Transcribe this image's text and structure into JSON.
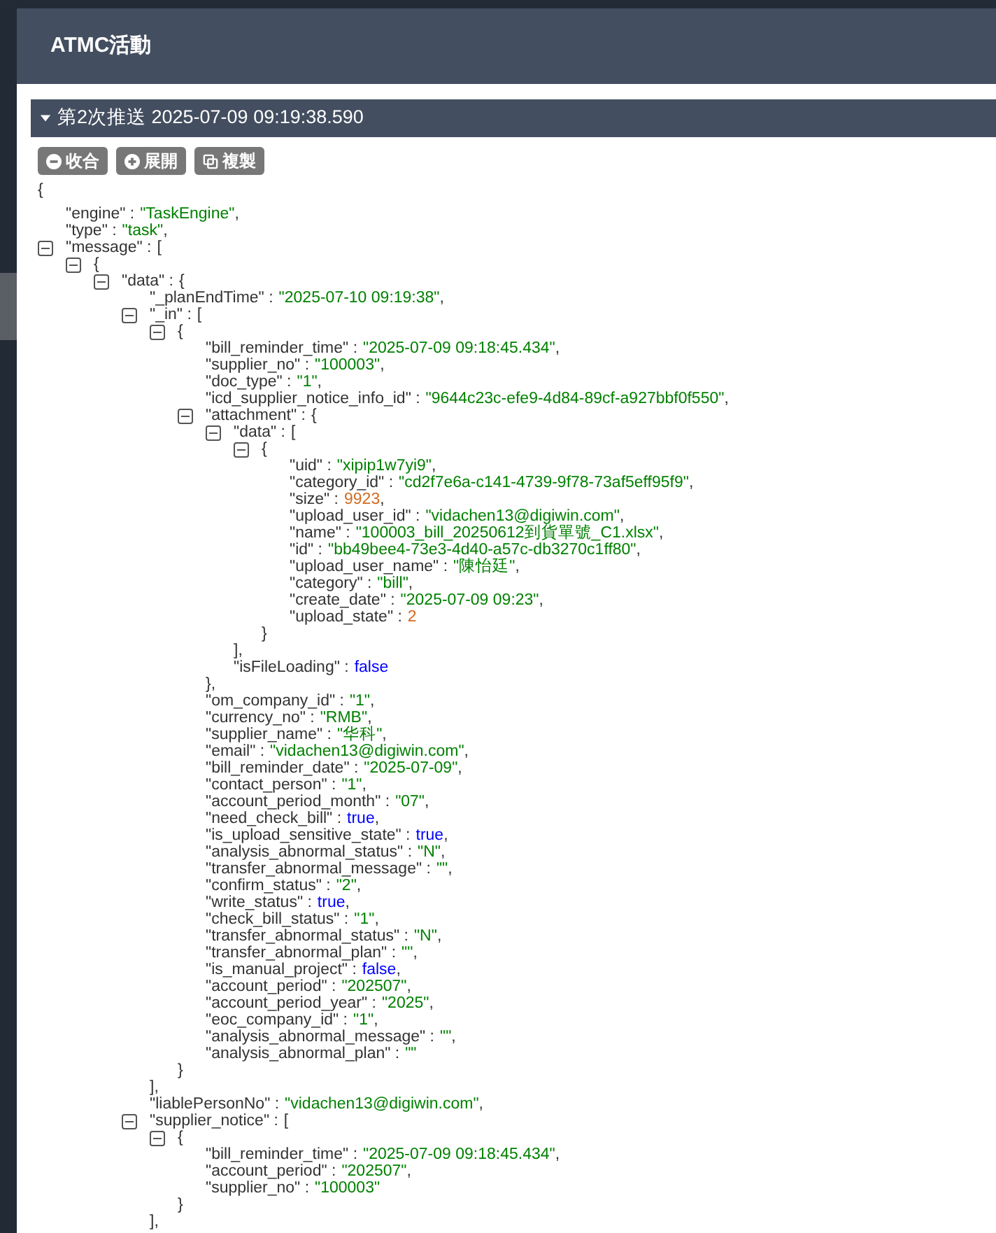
{
  "window": {
    "title": "ATMC活動"
  },
  "section": {
    "title": "第2次推送 2025-07-09 09:19:38.590",
    "expanded": true
  },
  "buttons": [
    {
      "label": "收合",
      "kind": "collapse"
    },
    {
      "label": "展開",
      "kind": "expand"
    },
    {
      "label": "複製",
      "kind": "copy"
    }
  ],
  "tree": {
    "kind": "root",
    "open": "{",
    "children": [
      {
        "kind": "value",
        "key": "\"engine\" :",
        "value": "\"TaskEngine\"",
        "color": "#008000",
        "tail": ","
      },
      {
        "kind": "value",
        "key": "\"type\" :",
        "value": "\"task\"",
        "color": "#008000",
        "tail": ","
      },
      {
        "kind": "container",
        "key": "\"message\" :",
        "open": "[",
        "expanded": true,
        "children": [
          {
            "kind": "container",
            "open": "{",
            "expanded": true,
            "children": [
              {
                "kind": "container",
                "key": "\"data\" :",
                "open": "{",
                "expanded": true,
                "children": [
                  {
                    "kind": "value",
                    "key": "\"_planEndTime\" :",
                    "value": "\"2025-07-10 09:19:38\"",
                    "color": "#008000",
                    "tail": ","
                  },
                  {
                    "kind": "container",
                    "key": "\"_in\" :",
                    "open": "[",
                    "expanded": true,
                    "children": [
                      {
                        "kind": "container",
                        "open": "{",
                        "expanded": true,
                        "children": [
                          {
                            "kind": "value",
                            "key": "\"bill_reminder_time\" :",
                            "value": "\"2025-07-09 09:18:45.434\"",
                            "color": "#008000",
                            "tail": ","
                          },
                          {
                            "kind": "value",
                            "key": "\"supplier_no\" :",
                            "value": "\"100003\"",
                            "color": "#008000",
                            "tail": ","
                          },
                          {
                            "kind": "value",
                            "key": "\"doc_type\" :",
                            "value": "\"1\"",
                            "color": "#008000",
                            "tail": ","
                          },
                          {
                            "kind": "value",
                            "key": "\"icd_supplier_notice_info_id\" :",
                            "value": "\"9644c23c-efe9-4d84-89cf-a927bbf0f550\"",
                            "color": "#008000",
                            "tail": ","
                          },
                          {
                            "kind": "container",
                            "key": "\"attachment\" :",
                            "open": "{",
                            "expanded": true,
                            "children": [
                              {
                                "kind": "container",
                                "key": "\"data\" :",
                                "open": "[",
                                "expanded": true,
                                "children": [
                                  {
                                    "kind": "container",
                                    "open": "{",
                                    "expanded": true,
                                    "children": [
                                      {
                                        "kind": "value",
                                        "key": "\"uid\" :",
                                        "value": "\"xipip1w7yi9\"",
                                        "color": "#008000",
                                        "tail": ","
                                      },
                                      {
                                        "kind": "value",
                                        "key": "\"category_id\" :",
                                        "value": "\"cd2f7e6a-c141-4739-9f78-73af5eff95f9\"",
                                        "color": "#008000",
                                        "tail": ","
                                      },
                                      {
                                        "kind": "value",
                                        "key": "\"size\" :",
                                        "value": "9923",
                                        "color": "#d2691e",
                                        "tail": ","
                                      },
                                      {
                                        "kind": "value",
                                        "key": "\"upload_user_id\" :",
                                        "value": "\"vidachen13@digiwin.com\"",
                                        "color": "#008000",
                                        "tail": ","
                                      },
                                      {
                                        "kind": "value",
                                        "key": "\"name\" :",
                                        "value": "\"100003_bill_20250612到貨單號_C1.xlsx\"",
                                        "color": "#008000",
                                        "tail": ","
                                      },
                                      {
                                        "kind": "value",
                                        "key": "\"id\" :",
                                        "value": "\"bb49bee4-73e3-4d40-a57c-db3270c1ff80\"",
                                        "color": "#008000",
                                        "tail": ","
                                      },
                                      {
                                        "kind": "value",
                                        "key": "\"upload_user_name\" :",
                                        "value": "\"陳怡廷\"",
                                        "color": "#008000",
                                        "tail": ","
                                      },
                                      {
                                        "kind": "value",
                                        "key": "\"category\" :",
                                        "value": "\"bill\"",
                                        "color": "#008000",
                                        "tail": ","
                                      },
                                      {
                                        "kind": "value",
                                        "key": "\"create_date\" :",
                                        "value": "\"2025-07-09 09:23\"",
                                        "color": "#008000",
                                        "tail": ","
                                      },
                                      {
                                        "kind": "value",
                                        "key": "\"upload_state\" :",
                                        "value": "2",
                                        "color": "#d2691e"
                                      }
                                    ],
                                    "close": "}"
                                  }
                                ],
                                "close": "],"
                              },
                              {
                                "kind": "value",
                                "key": "\"isFileLoading\" :",
                                "value": "false",
                                "color": "#0000ff"
                              }
                            ],
                            "close": "},"
                          },
                          {
                            "kind": "value",
                            "key": "\"om_company_id\" :",
                            "value": "\"1\"",
                            "color": "#008000",
                            "tail": ","
                          },
                          {
                            "kind": "value",
                            "key": "\"currency_no\" :",
                            "value": "\"RMB\"",
                            "color": "#008000",
                            "tail": ","
                          },
                          {
                            "kind": "value",
                            "key": "\"supplier_name\" :",
                            "value": "\"华科\"",
                            "color": "#008000",
                            "tail": ","
                          },
                          {
                            "kind": "value",
                            "key": "\"email\" :",
                            "value": "\"vidachen13@digiwin.com\"",
                            "color": "#008000",
                            "tail": ","
                          },
                          {
                            "kind": "value",
                            "key": "\"bill_reminder_date\" :",
                            "value": "\"2025-07-09\"",
                            "color": "#008000",
                            "tail": ","
                          },
                          {
                            "kind": "value",
                            "key": "\"contact_person\" :",
                            "value": "\"1\"",
                            "color": "#008000",
                            "tail": ","
                          },
                          {
                            "kind": "value",
                            "key": "\"account_period_month\" :",
                            "value": "\"07\"",
                            "color": "#008000",
                            "tail": ","
                          },
                          {
                            "kind": "value",
                            "key": "\"need_check_bill\" :",
                            "value": "true",
                            "color": "#0000ff",
                            "tail": ","
                          },
                          {
                            "kind": "value",
                            "key": "\"is_upload_sensitive_state\" :",
                            "value": "true",
                            "color": "#0000ff",
                            "tail": ","
                          },
                          {
                            "kind": "value",
                            "key": "\"analysis_abnormal_status\" :",
                            "value": "\"N\"",
                            "color": "#008000",
                            "tail": ","
                          },
                          {
                            "kind": "value",
                            "key": "\"transfer_abnormal_message\" :",
                            "value": "\"\"",
                            "color": "#008000",
                            "tail": ","
                          },
                          {
                            "kind": "value",
                            "key": "\"confirm_status\" :",
                            "value": "\"2\"",
                            "color": "#008000",
                            "tail": ","
                          },
                          {
                            "kind": "value",
                            "key": "\"write_status\" :",
                            "value": "true",
                            "color": "#0000ff",
                            "tail": ","
                          },
                          {
                            "kind": "value",
                            "key": "\"check_bill_status\" :",
                            "value": "\"1\"",
                            "color": "#008000",
                            "tail": ","
                          },
                          {
                            "kind": "value",
                            "key": "\"transfer_abnormal_status\" :",
                            "value": "\"N\"",
                            "color": "#008000",
                            "tail": ","
                          },
                          {
                            "kind": "value",
                            "key": "\"transfer_abnormal_plan\" :",
                            "value": "\"\"",
                            "color": "#008000",
                            "tail": ","
                          },
                          {
                            "kind": "value",
                            "key": "\"is_manual_project\" :",
                            "value": "false",
                            "color": "#0000ff",
                            "tail": ","
                          },
                          {
                            "kind": "value",
                            "key": "\"account_period\" :",
                            "value": "\"202507\"",
                            "color": "#008000",
                            "tail": ","
                          },
                          {
                            "kind": "value",
                            "key": "\"account_period_year\" :",
                            "value": "\"2025\"",
                            "color": "#008000",
                            "tail": ","
                          },
                          {
                            "kind": "value",
                            "key": "\"eoc_company_id\" :",
                            "value": "\"1\"",
                            "color": "#008000",
                            "tail": ","
                          },
                          {
                            "kind": "value",
                            "key": "\"analysis_abnormal_message\" :",
                            "value": "\"\"",
                            "color": "#008000",
                            "tail": ","
                          },
                          {
                            "kind": "value",
                            "key": "\"analysis_abnormal_plan\" :",
                            "value": "\"\"",
                            "color": "#008000"
                          }
                        ],
                        "close": "}"
                      }
                    ],
                    "close": "],"
                  },
                  {
                    "kind": "value",
                    "key": "\"liablePersonNo\" :",
                    "value": "\"vidachen13@digiwin.com\"",
                    "color": "#008000",
                    "tail": ","
                  },
                  {
                    "kind": "container",
                    "key": "\"supplier_notice\" :",
                    "open": "[",
                    "expanded": true,
                    "children": [
                      {
                        "kind": "container",
                        "open": "{",
                        "expanded": true,
                        "children": [
                          {
                            "kind": "value",
                            "key": "\"bill_reminder_time\" :",
                            "value": "\"2025-07-09 09:18:45.434\"",
                            "color": "#008000",
                            "tail": ","
                          },
                          {
                            "kind": "value",
                            "key": "\"account_period\" :",
                            "value": "\"202507\"",
                            "color": "#008000",
                            "tail": ","
                          },
                          {
                            "kind": "value",
                            "key": "\"supplier_no\" :",
                            "value": "\"100003\"",
                            "color": "#008000"
                          }
                        ],
                        "close": "}"
                      }
                    ],
                    "close": "],"
                  }
                ]
              }
            ]
          }
        ]
      }
    ]
  }
}
